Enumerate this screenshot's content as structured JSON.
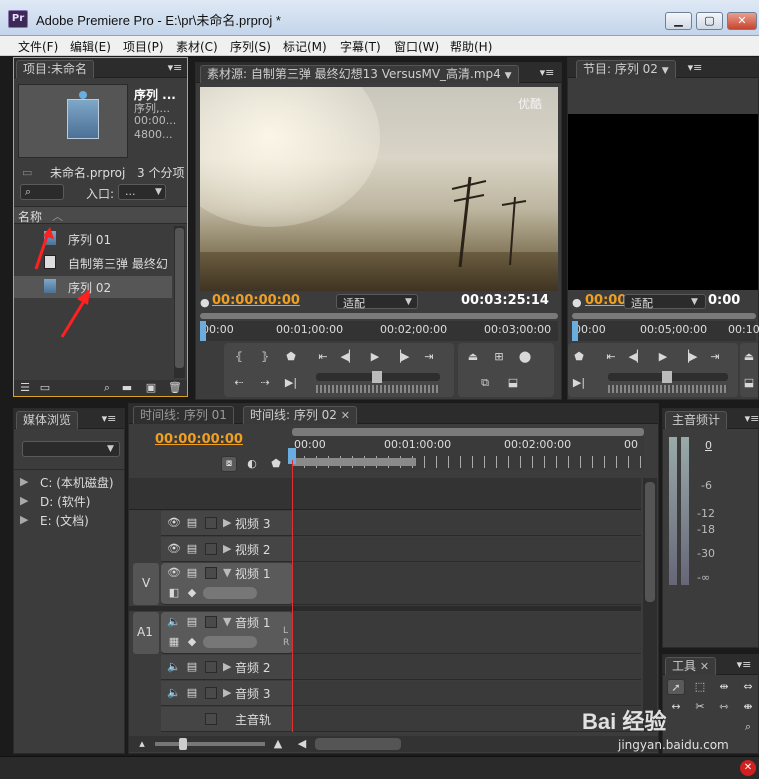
{
  "window": {
    "app_icon": "Pr",
    "title": "Adobe Premiere Pro - E:\\pr\\未命名.prproj *",
    "min_icon": "▁",
    "max_icon": "▢",
    "close_icon": "✕"
  },
  "menubar": {
    "items": [
      "文件(F)",
      "编辑(E)",
      "项目(P)",
      "素材(C)",
      "序列(S)",
      "标记(M)",
      "字幕(T)",
      "窗口(W)",
      "帮助(H)"
    ]
  },
  "project_panel": {
    "tab_label": "项目:未命名",
    "preview_name": "序列 ...",
    "preview_line2": "序列,...",
    "preview_line3": "00:00...",
    "preview_line4": "4800...",
    "project_file": "未命名.prproj",
    "item_count": "3 个分项",
    "entry_label": "入口:",
    "entry_value": "...",
    "column_name": "名称",
    "items": [
      {
        "label": "序列 01",
        "icon": "sequence-icon"
      },
      {
        "label": "自制第三弹 最终幻",
        "icon": "clip-icon"
      },
      {
        "label": "序列 02",
        "icon": "sequence-icon"
      }
    ]
  },
  "source_monitor": {
    "tab_label": "素材源: 自制第三弹 最终幻想13 VersusMV_高清.mp4",
    "watermark": "优酷",
    "current_time": "00:00:00:00",
    "fit_label": "适配",
    "duration": "00:03:25:14",
    "ruler": [
      "00:00",
      "00:01;00:00",
      "00:02;00:00",
      "00:03;00:00"
    ]
  },
  "program_monitor": {
    "tab_label": "节目: 序列 02",
    "current_time": "00:00",
    "fit_label": "适配",
    "duration": "0:00",
    "ruler": [
      "00:00",
      "00:05;00:00",
      "00:10;"
    ]
  },
  "media_browser": {
    "tab_label": "媒体浏览",
    "drives": [
      "C: (本机磁盘)",
      "D: (软件)",
      "E: (文档)"
    ]
  },
  "timeline": {
    "tab_inactive": "时间线: 序列 01",
    "tab_active": "时间线: 序列 02",
    "current_time": "00:00:00:00",
    "ruler": [
      "00:00",
      "00:01:00:00",
      "00:02:00:00",
      "00"
    ],
    "tracks": {
      "video3": "视频 3",
      "video2": "视频 2",
      "video1": "视频 1",
      "audio1": "音频 1",
      "audio2": "音频 2",
      "audio3": "音频 3",
      "master": "主音轨"
    },
    "v_target": "V",
    "a_target": "A1",
    "lr_l": "L",
    "lr_r": "R"
  },
  "audio_meter": {
    "tab_label": "主音频计",
    "scale": [
      "0",
      "-6",
      "-12",
      "-18",
      "-30",
      "-∞"
    ]
  },
  "tools": {
    "tab_label": "工具"
  },
  "watermark": {
    "brand": "Bai 经验",
    "url": "jingyan.baidu.com"
  },
  "colors": {
    "accent_orange": "#f0a020",
    "playhead_red": "#e03030",
    "panel_bg": "#3c3c3c",
    "arrow_red": "#ff2020"
  }
}
